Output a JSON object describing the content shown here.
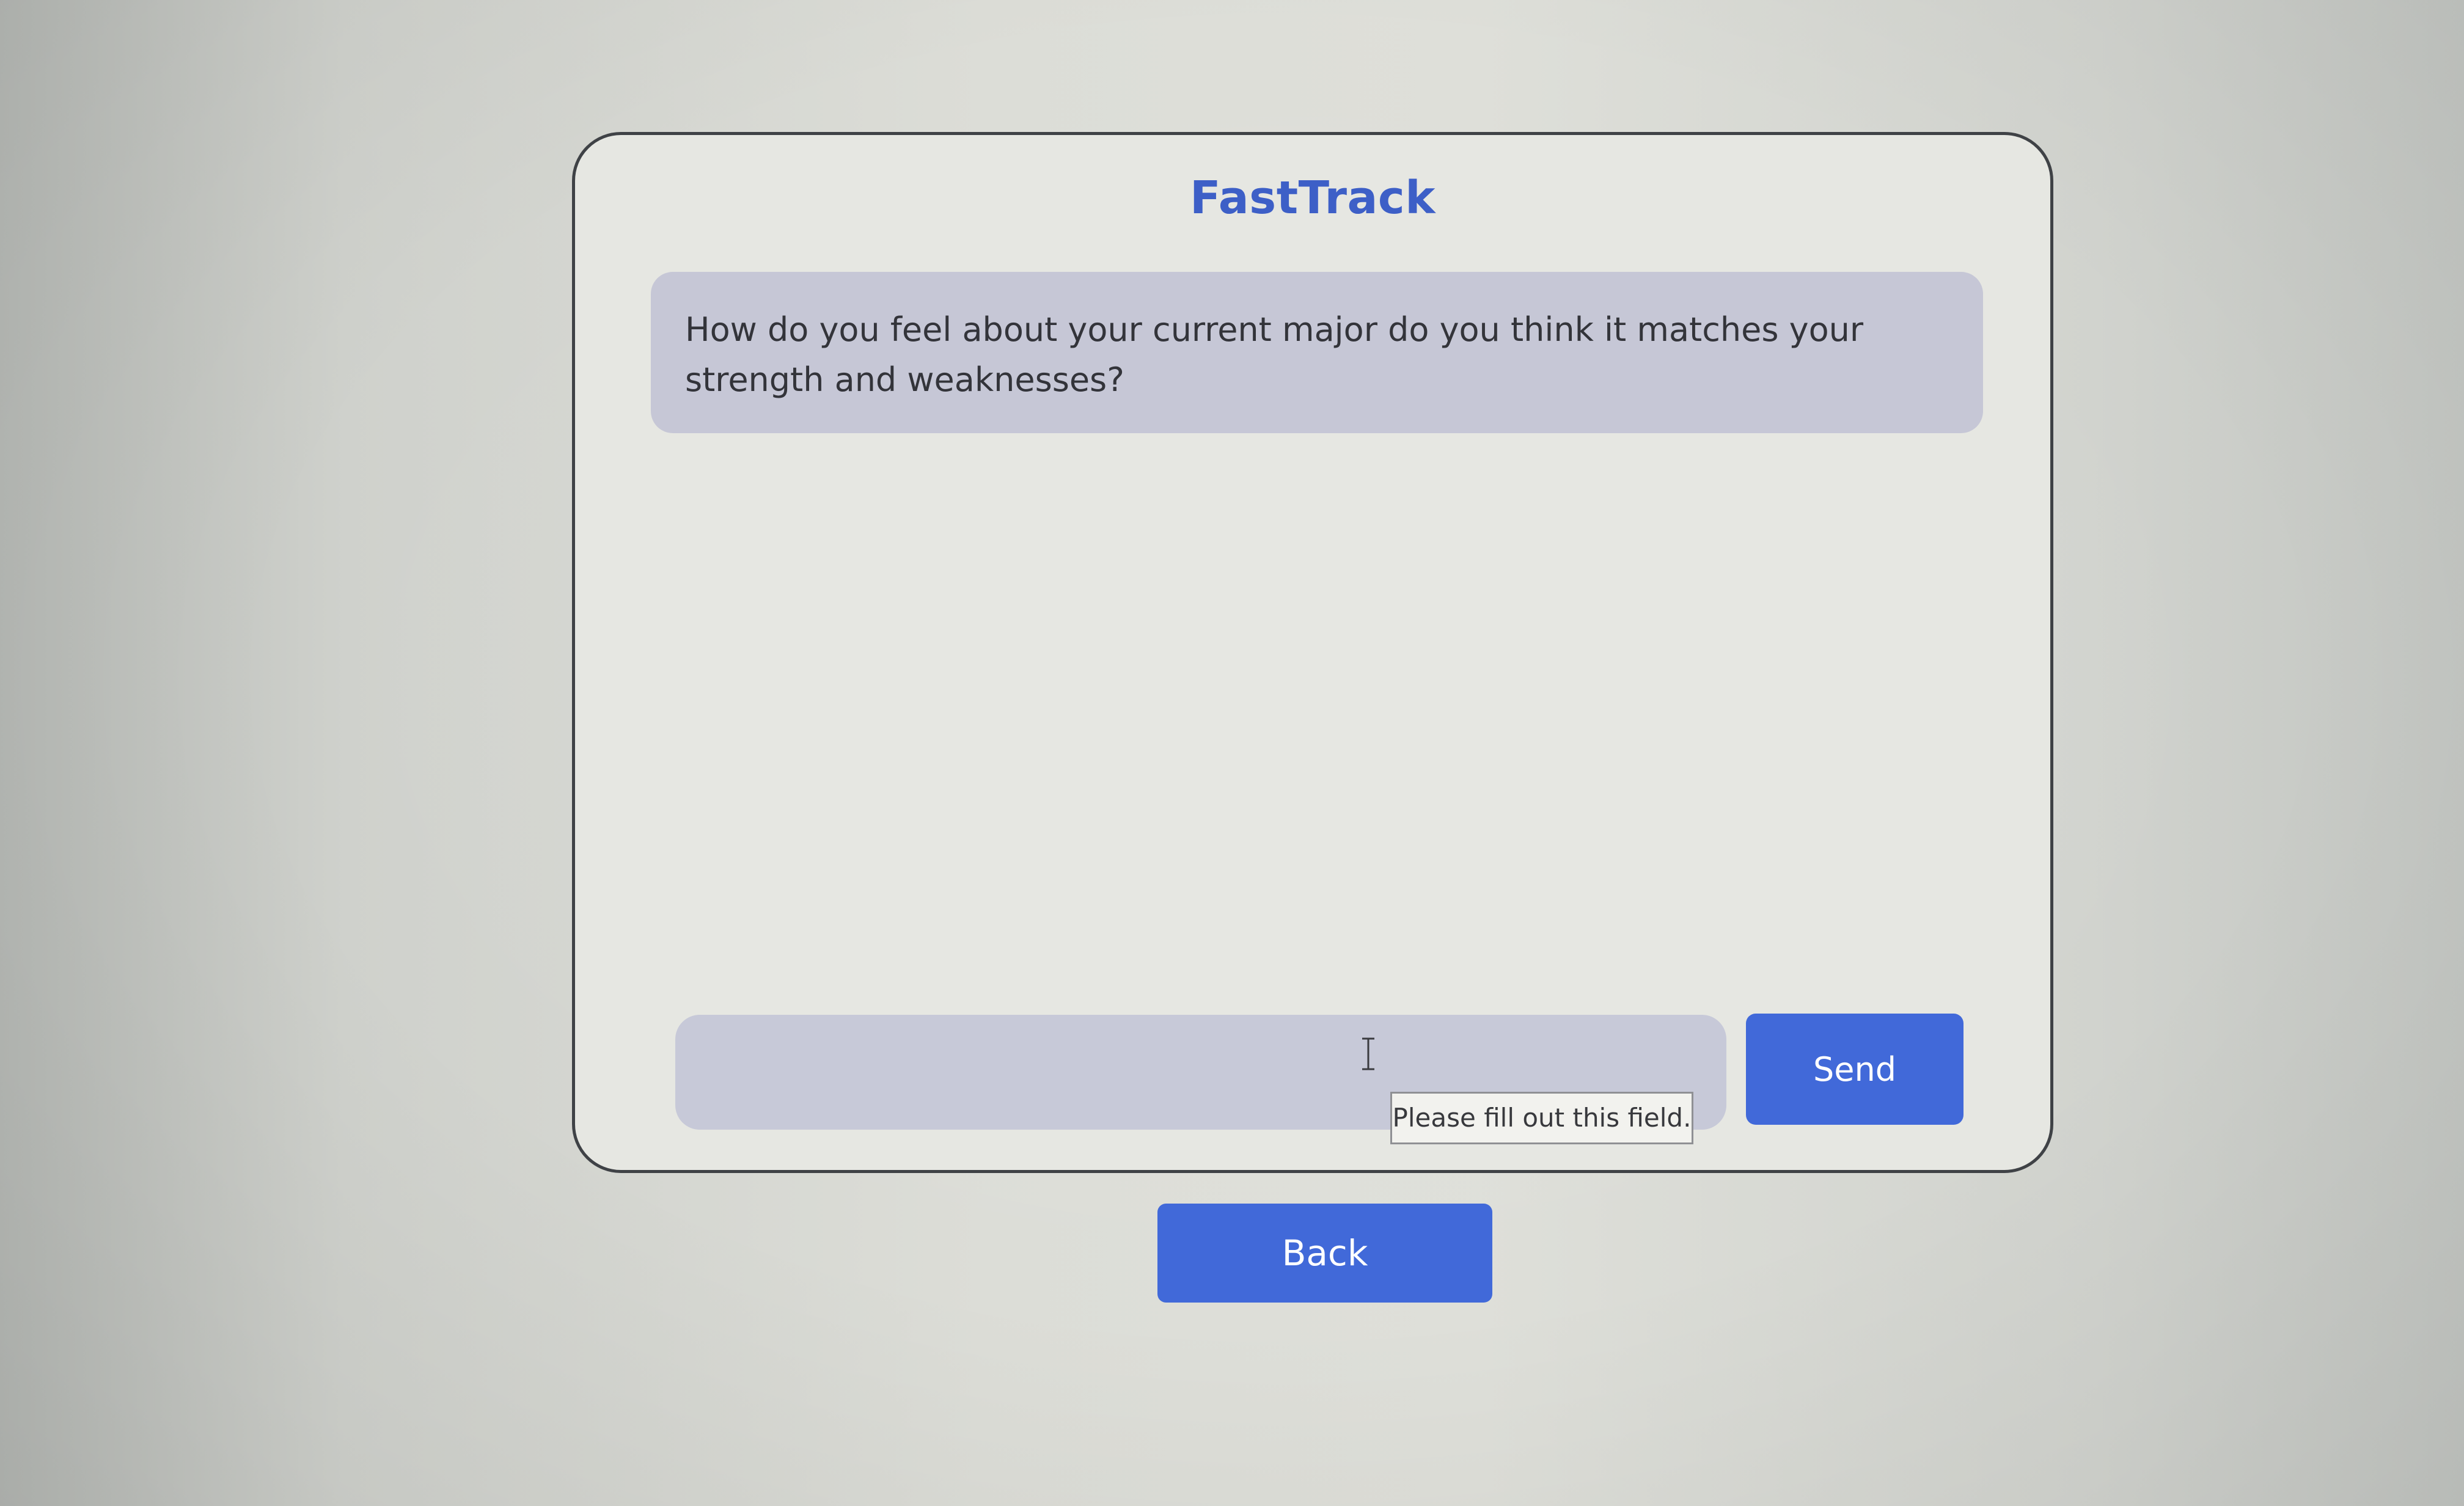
{
  "app": {
    "title": "FastTrack"
  },
  "chat": {
    "question": "How do you feel about your current major do you think it matches your strength and weaknesses?"
  },
  "composer": {
    "input_value": "",
    "input_placeholder": "",
    "send_label": "Send",
    "validation_message": "Please fill out this field."
  },
  "navigation": {
    "back_label": "Back"
  },
  "colors": {
    "accent": "#4169d9",
    "title": "#3d5fc7",
    "bubble": "#c6c7d6",
    "input_background": "#c7c9d8"
  },
  "icons": {
    "cursor": "text-cursor-icon"
  }
}
